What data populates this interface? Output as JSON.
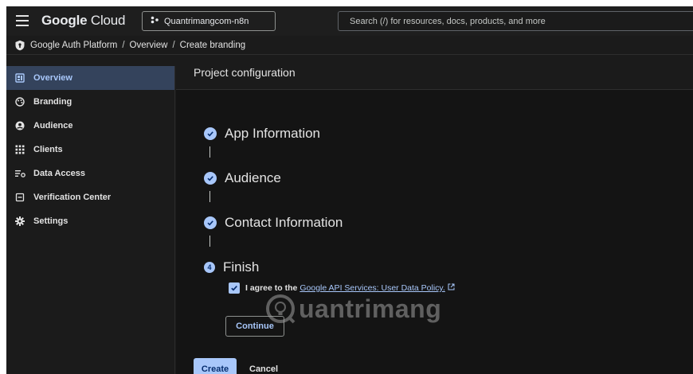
{
  "topbar": {
    "brand_google": "Google",
    "brand_cloud": "Cloud",
    "project": "Quantrimangcom-n8n",
    "search_placeholder": "Search (/) for resources, docs, products, and more"
  },
  "breadcrumb": [
    "Google Auth Platform",
    "Overview",
    "Create branding"
  ],
  "breadcrumb_sep": "/",
  "sidebar": {
    "items": [
      {
        "label": "Overview",
        "icon": "dashboard-icon",
        "active": true
      },
      {
        "label": "Branding",
        "icon": "palette-icon"
      },
      {
        "label": "Audience",
        "icon": "account-icon"
      },
      {
        "label": "Clients",
        "icon": "grid-icon"
      },
      {
        "label": "Data Access",
        "icon": "data-access-icon"
      },
      {
        "label": "Verification Center",
        "icon": "checklist-icon"
      },
      {
        "label": "Settings",
        "icon": "gear-icon"
      }
    ]
  },
  "main": {
    "title": "Project configuration",
    "steps": [
      {
        "label": "App Information",
        "status": "complete"
      },
      {
        "label": "Audience",
        "status": "complete"
      },
      {
        "label": "Contact Information",
        "status": "complete"
      },
      {
        "label": "Finish",
        "status": "current",
        "number": "4"
      }
    ],
    "agree_text": "I agree to the",
    "agree_link": "Google API Services: User Data Policy.",
    "agree_checked": true,
    "continue_label": "Continue",
    "create_label": "Create",
    "cancel_label": "Cancel",
    "watermark": "uantrimang"
  },
  "colors": {
    "accent": "#a8c7fa",
    "active_nav_bg": "#34435c",
    "background": "#141414"
  }
}
